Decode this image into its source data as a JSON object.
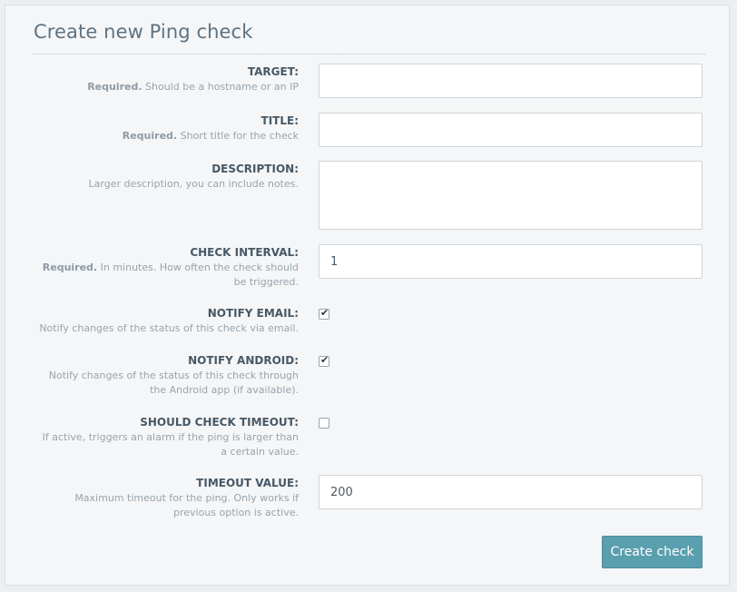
{
  "form": {
    "title": "Create new Ping check",
    "fields": [
      {
        "label": "TARGET:",
        "required": "Required.",
        "help": " Should be a hostname or an IP",
        "value": ""
      },
      {
        "label": "TITLE:",
        "required": "Required.",
        "help": " Short title for the check",
        "value": ""
      },
      {
        "label": "DESCRIPTION:",
        "required": "",
        "help": "Larger description, you can include notes.",
        "value": ""
      },
      {
        "label": "CHECK INTERVAL:",
        "required": "Required.",
        "help": " In minutes. How often the check should be triggered.",
        "value": "1"
      },
      {
        "label": "NOTIFY EMAIL:",
        "required": "",
        "help": "Notify changes of the status of this check via email.",
        "checked": true
      },
      {
        "label": "NOTIFY ANDROID:",
        "required": "",
        "help": "Notify changes of the status of this check through the Android app (if available).",
        "checked": true
      },
      {
        "label": "SHOULD CHECK TIMEOUT:",
        "required": "",
        "help": "If active, triggers an alarm if the ping is larger than a certain value.",
        "checked": false
      },
      {
        "label": "TIMEOUT VALUE:",
        "required": "",
        "help": "Maximum timeout for the ping. Only works if previous option is active.",
        "value": "200"
      }
    ],
    "submit_label": "Create check",
    "check_glyph": "✔"
  },
  "colors": {
    "accent": "#5a9fae",
    "panel_bg": "#f5f6f7",
    "title": "#5d7384"
  }
}
